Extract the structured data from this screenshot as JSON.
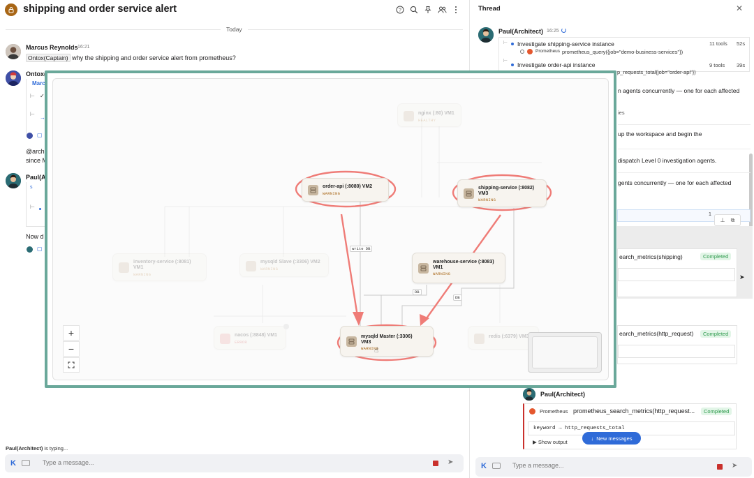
{
  "channel": {
    "title": "shipping and order service alert",
    "day_label": "Today"
  },
  "messages": [
    {
      "sender": "Marcus Reynolds",
      "time": "16:21",
      "mention": "Ontox(Captain)",
      "text": "why the shipping and order service alert from prometheus?"
    },
    {
      "sender": "Ontox(C",
      "fragment": "Marc"
    },
    {
      "text_line1": "@arch",
      "text_line2": "since M"
    },
    {
      "sender": "Paul(A"
    },
    {
      "text": "Now d"
    }
  ],
  "composer": {
    "typing_user": "Paul(Architect)",
    "typing_suffix": " is typing...",
    "placeholder": "Type a message...",
    "k_label": "K"
  },
  "thread": {
    "title": "Thread",
    "author": "Paul(Architect)",
    "time": "16:25",
    "tasks": [
      {
        "name": "Investigate shipping-service instance",
        "tools": "11 tools",
        "duration": "52s",
        "source": "Prometheus",
        "query": "prometheus_query({job=\"demo-business-services\"})"
      },
      {
        "name": "Investigate order-api instance",
        "tools": "9 tools",
        "duration": "39s",
        "query_fragment": "p_requests_total{job=\"order-api\"})"
      }
    ],
    "lines": [
      "n agents concurrently — one for each affected",
      "ies",
      "up the workspace and begin the",
      "dispatch Level 0 investigation agents.",
      "gents concurrently — one for each affected"
    ],
    "row_count": "1",
    "tool_calls": [
      {
        "fn": "earch_metrics(shipping)",
        "status": "Completed"
      },
      {
        "fn": "earch_metrics(http_request)",
        "status": "Completed"
      }
    ],
    "bottom_author": "Paul(Architect)",
    "bottom_call": {
      "source": "Prometheus",
      "fn": "prometheus_search_metrics(http_request...",
      "status": "Completed",
      "code": "keyword → http_requests_total",
      "show_output": "▶ Show output"
    },
    "new_messages": "New messages"
  },
  "diagram": {
    "nodes": [
      {
        "id": "nginx",
        "title": "nginx (:80) VM1",
        "status": "HEALTHY",
        "faded": true
      },
      {
        "id": "order-api",
        "title": "order-api (:8080) VM2",
        "status": "WARNING",
        "faded": false
      },
      {
        "id": "shipping",
        "title": "shipping-service (:8082)",
        "title2": "VM3",
        "status": "WARNING",
        "faded": false
      },
      {
        "id": "inventory",
        "title": "inventory-service (:8081)",
        "title2": "VM1",
        "status": "WARNING",
        "faded": true
      },
      {
        "id": "mysql-slave",
        "title": "mysqld Slave (:3306) VM2",
        "status": "WARNING",
        "faded": true
      },
      {
        "id": "warehouse",
        "title": "warehouse-service (:8083)",
        "title2": "VM1",
        "status": "WARNING",
        "faded": false
      },
      {
        "id": "nacos",
        "title": "nacos (:8848) VM1",
        "status": "ERROR",
        "faded": true
      },
      {
        "id": "mysql-master",
        "title": "mysqld Master (:3306)",
        "title2": "VM3",
        "status": "WARNING",
        "faded": false
      },
      {
        "id": "redis",
        "title": "redis (:6379) VM3",
        "status": "",
        "faded": true
      }
    ],
    "edges": [
      {
        "label": "write DB"
      },
      {
        "label": "DB"
      },
      {
        "label": "DB"
      }
    ],
    "zoom": {
      "in": "+",
      "out": "−",
      "fit": "⛶"
    }
  },
  "colors": {
    "overlay_border": "#6aa89a",
    "highlight": "#ef7c77",
    "warning_text": "#a86616",
    "brand_blue": "#2f6bd8",
    "completed_bg": "#e2f5e7",
    "completed_fg": "#2e9a4d"
  }
}
